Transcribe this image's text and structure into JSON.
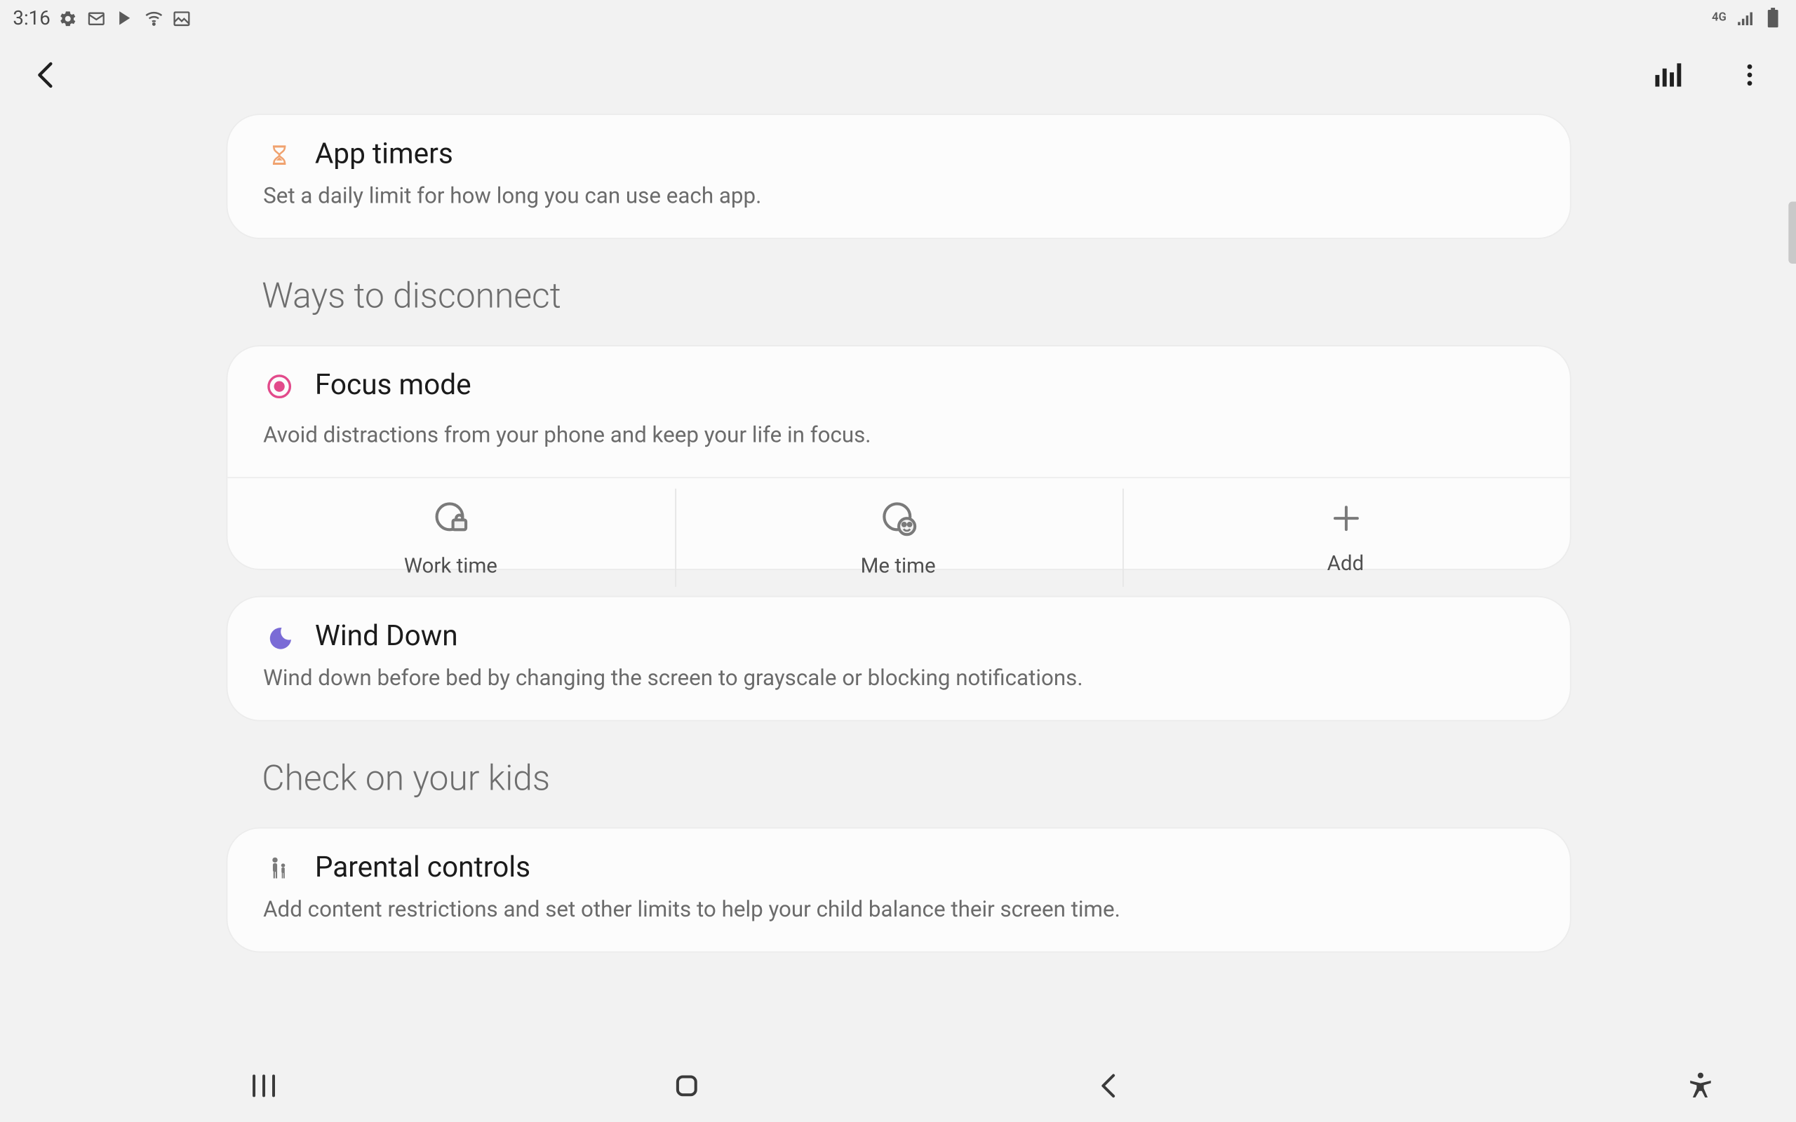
{
  "status": {
    "time": "3:16",
    "network_label": "4G"
  },
  "app_timers": {
    "title": "App timers",
    "subtitle": "Set a daily limit for how long you can use each app."
  },
  "section_disconnect": "Ways to disconnect",
  "focus_mode": {
    "title": "Focus mode",
    "subtitle": "Avoid distractions from your phone and keep your life in focus.",
    "modes": [
      {
        "label": "Work time"
      },
      {
        "label": "Me time"
      },
      {
        "label": "Add"
      }
    ]
  },
  "wind_down": {
    "title": "Wind Down",
    "subtitle": "Wind down before bed by changing the screen to grayscale or blocking notifications."
  },
  "section_kids": "Check on your kids",
  "parental": {
    "title": "Parental controls",
    "subtitle": "Add content restrictions and set other limits to help your child balance their screen time."
  },
  "colors": {
    "hourglass": "#f0a26f",
    "focus_ring": "#e24a8b",
    "moon": "#7a6bd6",
    "parent": "#7a7a7a"
  }
}
